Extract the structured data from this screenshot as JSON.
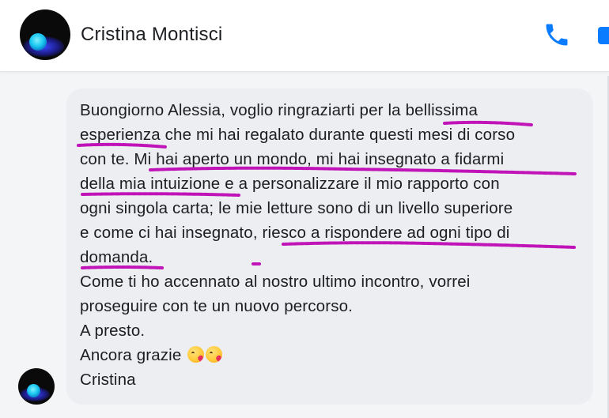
{
  "header": {
    "contact_name": "Cristina Montisci",
    "call_icon": "phone-icon",
    "video_icon": "video-camera-icon"
  },
  "message": {
    "lines": [
      "Buongiorno Alessia, voglio ringraziarti per la bellissima",
      "esperienza che mi hai regalato durante questi mesi di corso",
      "con te. Mi hai aperto un mondo, mi hai insegnato a fidarmi",
      "della mia intuizione e a personalizzare il mio rapporto con",
      "ogni singola carta; le mie letture sono di un livello superiore",
      "e come ci hai insegnato, riesco a rispondere ad ogni tipo di",
      "domanda.",
      "Come ti ho accennato al nostro ultimo incontro, vorrei",
      "proseguire con te un nuovo percorso.",
      "A presto.",
      "Ancora grazie",
      "Cristina"
    ],
    "emoji": [
      "face-blowing-a-kiss-emoji",
      "face-blowing-a-kiss-emoji"
    ]
  },
  "colors": {
    "accent": "#0a7cff",
    "bubble": "#eceef1",
    "highlight": "#c013b8"
  }
}
